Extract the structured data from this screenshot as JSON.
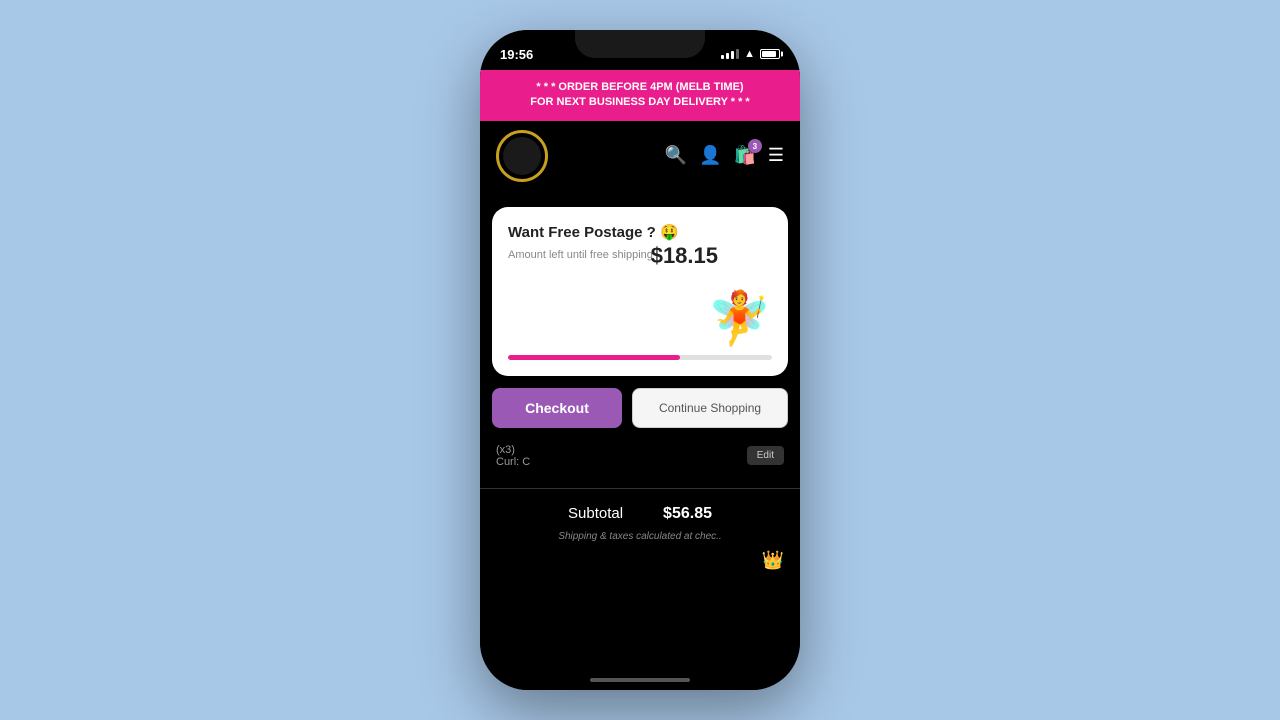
{
  "phone": {
    "status_bar": {
      "time": "19:56"
    },
    "banner": {
      "text": "* * * ORDER BEFORE 4PM (MELB TIME)\nFOR NEXT BUSINESS DAY DELIVERY * * *",
      "line1": "* * * ORDER BEFORE 4PM (MELB TIME)",
      "line2": "FOR NEXT BUSINESS DAY DELIVERY * * *",
      "bg_color": "#e91e8c"
    },
    "nav": {
      "cart_count": "3"
    },
    "free_postage_card": {
      "title": "Want Free Postage ?  🤑",
      "subtitle": "Amount left until free shipping",
      "amount": "$18.15",
      "progress_percent": 65
    },
    "buttons": {
      "checkout_label": "Checkout",
      "continue_label": "Continue Shopping"
    },
    "cart_item": {
      "quantity": "(x3)",
      "curl": "Curl:  C",
      "edit_label": "Edit"
    },
    "subtotal": {
      "label": "Subtotal",
      "amount": "$56.85"
    },
    "shipping_note": "Shipping & taxes calculated at chec.."
  }
}
